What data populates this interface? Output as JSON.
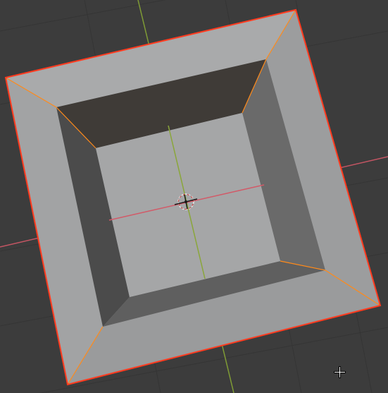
{
  "viewport": {
    "name": "3d-viewport",
    "background": "#3c3c3c",
    "grid_color": "#353535",
    "axis_x_color": "#c45563",
    "axis_y_color": "#7f9b35"
  },
  "mesh": {
    "name": "hollow-box",
    "outer_face_color": "#9fa0a1",
    "selection_outline_color": "#ff3b1f",
    "edge_highlight_color": "#ff8a1a",
    "inner_floor_color": "#a5a6a7",
    "inner_wall_top_color": "#3f3b37",
    "inner_wall_left_color": "#4b4b4b",
    "inner_wall_right_color": "#6a6a6a",
    "inner_wall_bottom_color": "#5f5f5f"
  },
  "origin": {
    "name": "object-origin",
    "color": "#e8e8e8"
  },
  "cursor": {
    "icon": "crosshair-cursor-icon"
  }
}
